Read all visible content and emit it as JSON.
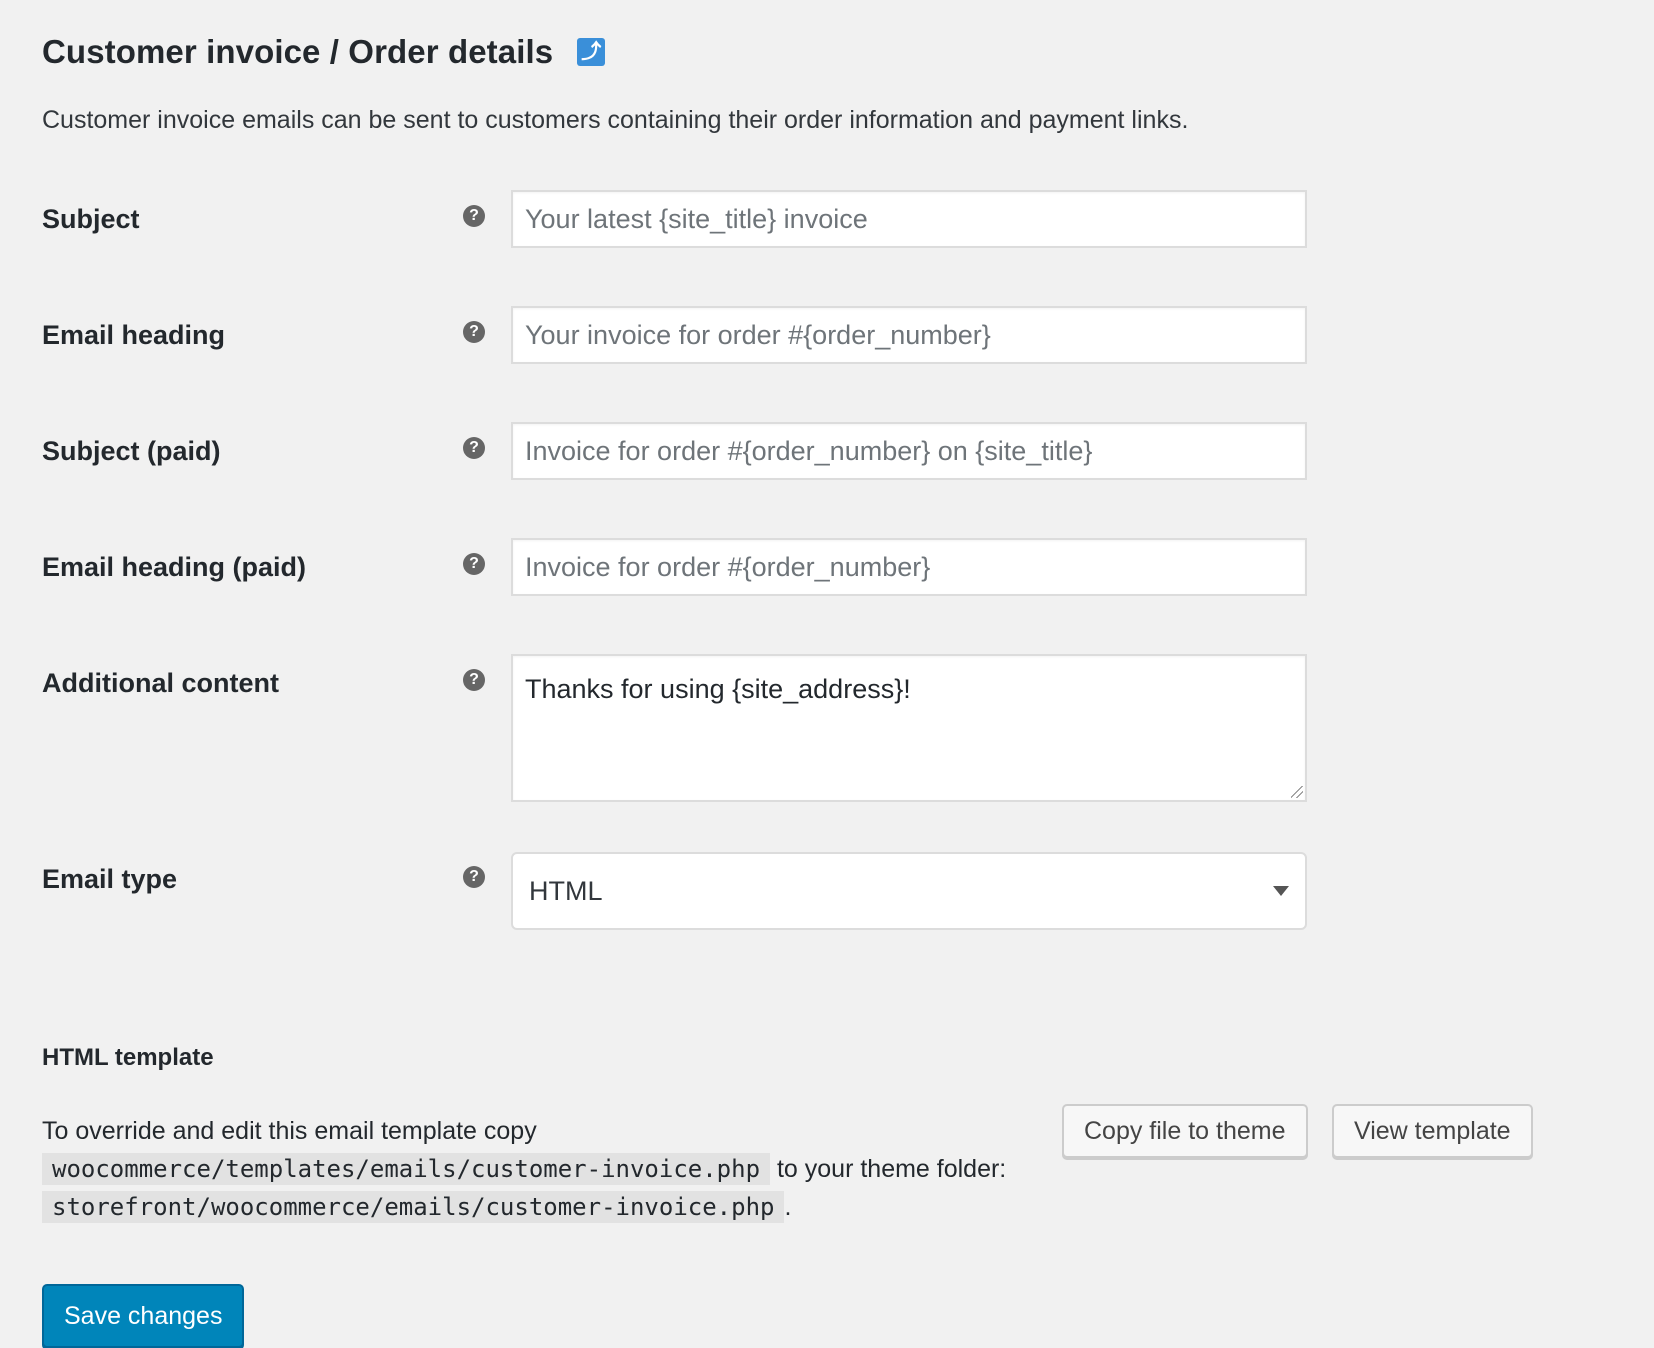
{
  "header": {
    "title": "Customer invoice / Order details",
    "back_icon": "return-arrow-icon",
    "back_icon_glyph": "⤴",
    "description": "Customer invoice emails can be sent to customers containing their order information and payment links."
  },
  "help_glyph": "?",
  "fields": {
    "subject": {
      "label": "Subject",
      "value": "",
      "placeholder": "Your latest {site_title} invoice"
    },
    "heading": {
      "label": "Email heading",
      "value": "",
      "placeholder": "Your invoice for order #{order_number}"
    },
    "subject_paid": {
      "label": "Subject (paid)",
      "value": "",
      "placeholder": "Invoice for order #{order_number} on {site_title}"
    },
    "heading_paid": {
      "label": "Email heading (paid)",
      "value": "",
      "placeholder": "Invoice for order #{order_number}"
    },
    "additional_content": {
      "label": "Additional content",
      "value": "Thanks for using {site_address}!"
    },
    "email_type": {
      "label": "Email type",
      "selected": "HTML"
    }
  },
  "template": {
    "heading": "HTML template",
    "text_before": "To override and edit this email template copy",
    "source_path": "woocommerce/templates/emails/customer-invoice.php",
    "text_middle": "to your theme folder:",
    "dest_path": "storefront/woocommerce/emails/customer-invoice.php",
    "text_after": ".",
    "copy_button": "Copy file to theme",
    "view_button": "View template"
  },
  "save_button": "Save changes",
  "colors": {
    "background": "#f1f1f1",
    "primary": "#0085ba",
    "accent_icon": "#3a8fd9"
  }
}
